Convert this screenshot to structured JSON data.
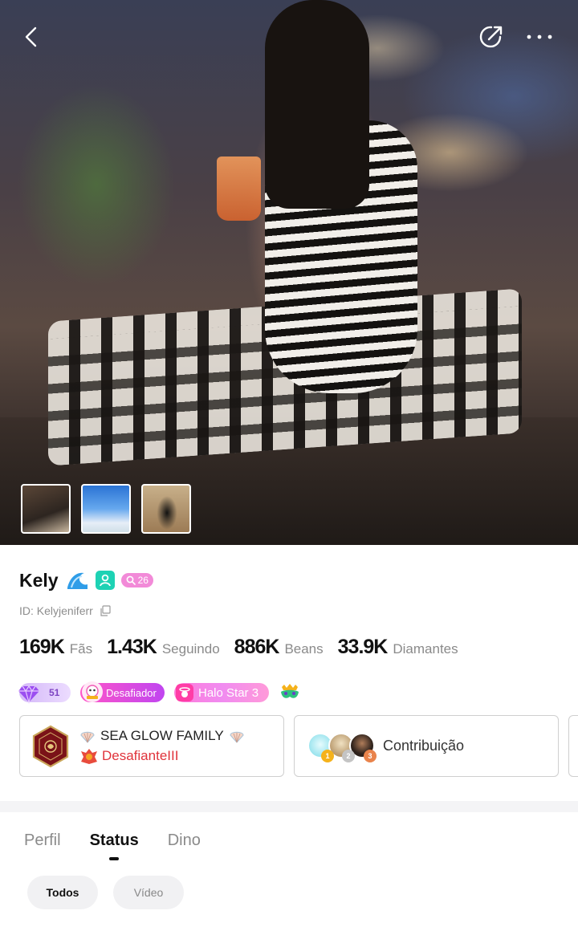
{
  "profile": {
    "name": "Kely",
    "level": "26",
    "id_label": "ID: Kelyjeniferr"
  },
  "stats": [
    {
      "value": "169K",
      "label": "Fãs"
    },
    {
      "value": "1.43K",
      "label": "Seguindo"
    },
    {
      "value": "886K",
      "label": "Beans"
    },
    {
      "value": "33.9K",
      "label": "Diamantes"
    }
  ],
  "badges": {
    "gem_level": "51",
    "desafiador": "Desafiador",
    "halo": "Halo Star 3"
  },
  "family": {
    "name": "SEA GLOW FAMILY",
    "rank": "DesafianteIII"
  },
  "contribution": {
    "label": "Contribuição",
    "medals": [
      "1",
      "2",
      "3"
    ]
  },
  "tabs": [
    {
      "label": "Perfil",
      "active": false
    },
    {
      "label": "Status",
      "active": true
    },
    {
      "label": "Dino",
      "active": false
    }
  ],
  "filters": [
    {
      "label": "Todos",
      "active": true
    },
    {
      "label": "Vídeo",
      "active": false
    }
  ],
  "icons": {
    "back": "chevron-left-icon",
    "share": "share-icon",
    "more": "more-dots-icon",
    "copy": "copy-icon"
  },
  "colors": {
    "verified": "#1ed2b4",
    "level_badge": "#f28ad8",
    "rank_text": "#e0333b"
  }
}
